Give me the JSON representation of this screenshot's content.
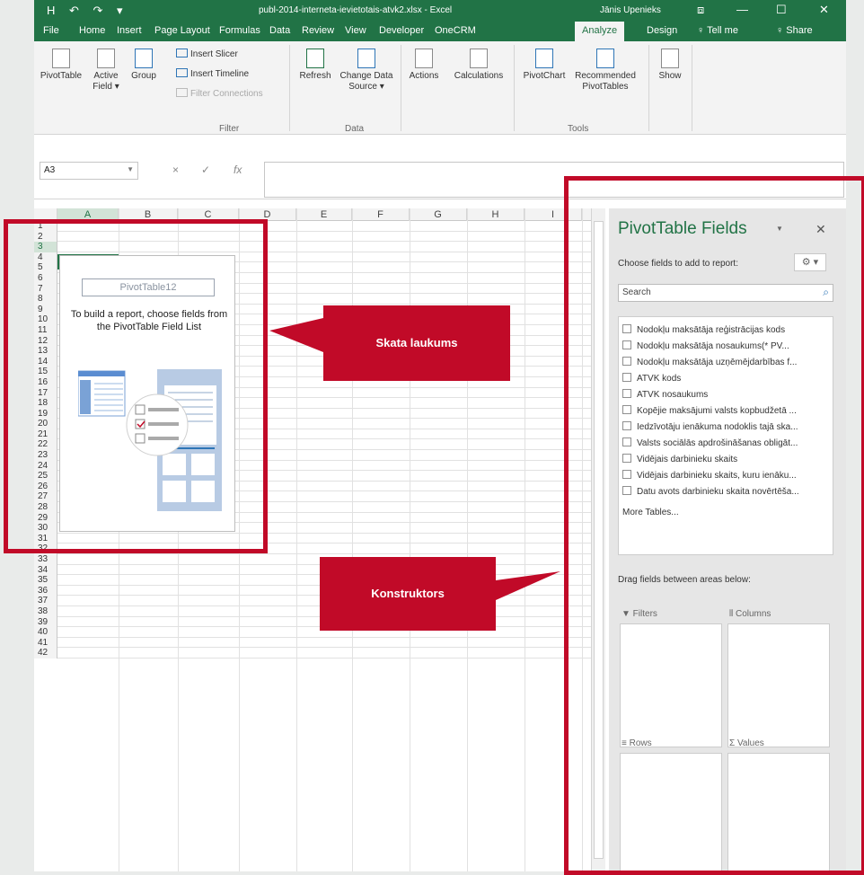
{
  "titlebar": {
    "qat": "H ↶ ↷ ▾",
    "title": "publ-2014-interneta-ievietotais-atvk2.xlsx - Excel",
    "user": "Jānis Upenieks",
    "btn_restore": "⧈",
    "btn_min": "—",
    "btn_max": "☐",
    "btn_close": "✕"
  },
  "tabs": {
    "file": "File",
    "home": "Home",
    "insert": "Insert",
    "page_layout": "Page Layout",
    "formulas": "Formulas",
    "data": "Data",
    "review": "Review",
    "view": "View",
    "developer": "Developer",
    "onecrm": "OneCRM",
    "analyze": "Analyze",
    "design": "Design",
    "tell_me": "♀ Tell me",
    "share": "♀ Share"
  },
  "ribbon": {
    "pivottable": "PivotTable",
    "active_field_1": "Active",
    "active_field_2": "Field ▾",
    "group": "Group",
    "insert_slicer": "Insert Slicer",
    "insert_timeline": "Insert Timeline",
    "filter_connections": "Filter Connections",
    "filter_group": "Filter",
    "refresh": "Refresh",
    "change_data_1": "Change Data",
    "change_data_2": "Source ▾",
    "data_group": "Data",
    "actions": "Actions",
    "calculations": "Calculations",
    "pivotchart": "PivotChart",
    "recommended_1": "Recommended",
    "recommended_2": "PivotTables",
    "tools_group": "Tools",
    "show": "Show"
  },
  "formula_bar": {
    "name_box": "A3",
    "cancel": "×",
    "enter": "✓",
    "fx": "fx"
  },
  "sheet": {
    "columns": [
      "A",
      "B",
      "C",
      "D",
      "E",
      "F",
      "G",
      "H",
      "I"
    ],
    "selected_column": "A",
    "rows": [
      "1",
      "2",
      "3",
      "4",
      "5",
      "6",
      "7",
      "8",
      "9",
      "10",
      "11",
      "12",
      "13",
      "14",
      "15",
      "16",
      "17",
      "18",
      "19",
      "20",
      "21",
      "22",
      "23",
      "24",
      "25",
      "26",
      "27",
      "28",
      "29",
      "30",
      "31",
      "32",
      "33",
      "34",
      "35",
      "36",
      "37",
      "38",
      "39",
      "40",
      "41",
      "42"
    ],
    "selected_row": "3"
  },
  "pivot_placeholder": {
    "name": "PivotTable12",
    "instructions": "To build a report, choose fields from the PivotTable Field List"
  },
  "field_pane": {
    "title": "PivotTable Fields",
    "choose": "Choose fields to add to report:",
    "search_placeholder": "Search",
    "fields": [
      "Nodokļu maksātāja reģistrācijas kods",
      "Nodokļu maksātāja nosaukums(* PV...",
      "Nodokļu maksātāja uzņēmējdarbības f...",
      "ATVK kods",
      "ATVK nosaukums",
      "Kopējie maksājumi valsts kopbudžetā ...",
      "Iedzīvotāju ienākuma nodoklis tajā ska...",
      "Valsts sociālās apdrošināšanas obligāt...",
      "Vidējais darbinieku skaits",
      "Vidējais darbinieku skaits, kuru ienāku...",
      "Datu avots darbinieku skaita novērtēša..."
    ],
    "more_tables": "More Tables...",
    "drag": "Drag fields between areas below:",
    "filters": "▼ Filters",
    "columns": "⫴ Columns",
    "rows": "≡ Rows",
    "values": "Σ Values"
  },
  "callouts": {
    "skata": "Skata laukums",
    "konstruktors": "Konstruktors"
  },
  "colors": {
    "excel_green": "#217346",
    "callout_red": "#c10a28"
  }
}
